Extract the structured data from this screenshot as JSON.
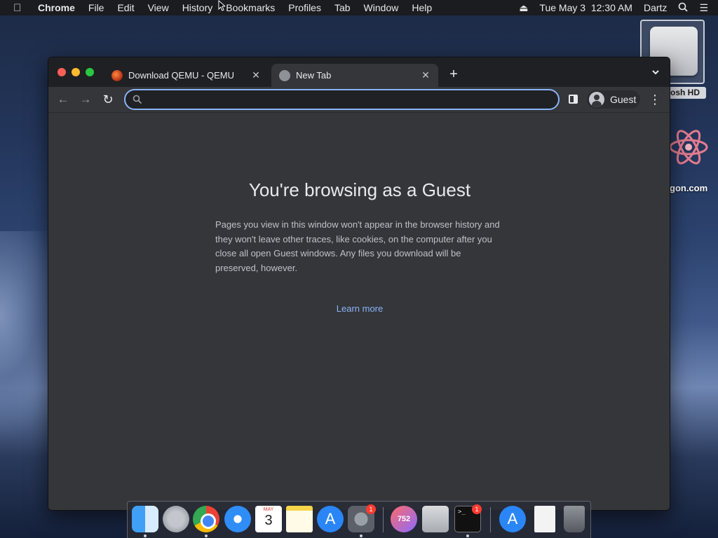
{
  "menubar": {
    "app": "Chrome",
    "items": [
      "File",
      "Edit",
      "View",
      "History",
      "Bookmarks",
      "Profiles",
      "Tab",
      "Window",
      "Help"
    ],
    "datetime": "Tue May 3  12:30 AM",
    "user": "Dartz"
  },
  "desktop": {
    "hd_label": "osh HD",
    "qemu_label": "gon.com"
  },
  "browser": {
    "tabs": [
      {
        "title": "Download QEMU - QEMU",
        "favicon": "qemu-icon",
        "active": false
      },
      {
        "title": "New Tab",
        "favicon": "globe-icon",
        "active": true
      }
    ],
    "omnibox": {
      "value": "",
      "placeholder": ""
    },
    "profile_label": "Guest",
    "accent_color": "#8ab4f8"
  },
  "guest_page": {
    "title": "You're browsing as a Guest",
    "body": "Pages you view in this window won't appear in the browser history and they won't leave other traces, like cookies, on the computer after you close all open Guest windows. Any files you download will be preserved, however.",
    "link": "Learn more"
  },
  "dock": {
    "calendar_month": "MAY",
    "calendar_day": "3",
    "badge_syspref": "1",
    "app_752_label": "752",
    "terminal_prompt": ">_",
    "badge_terminal": "1"
  }
}
